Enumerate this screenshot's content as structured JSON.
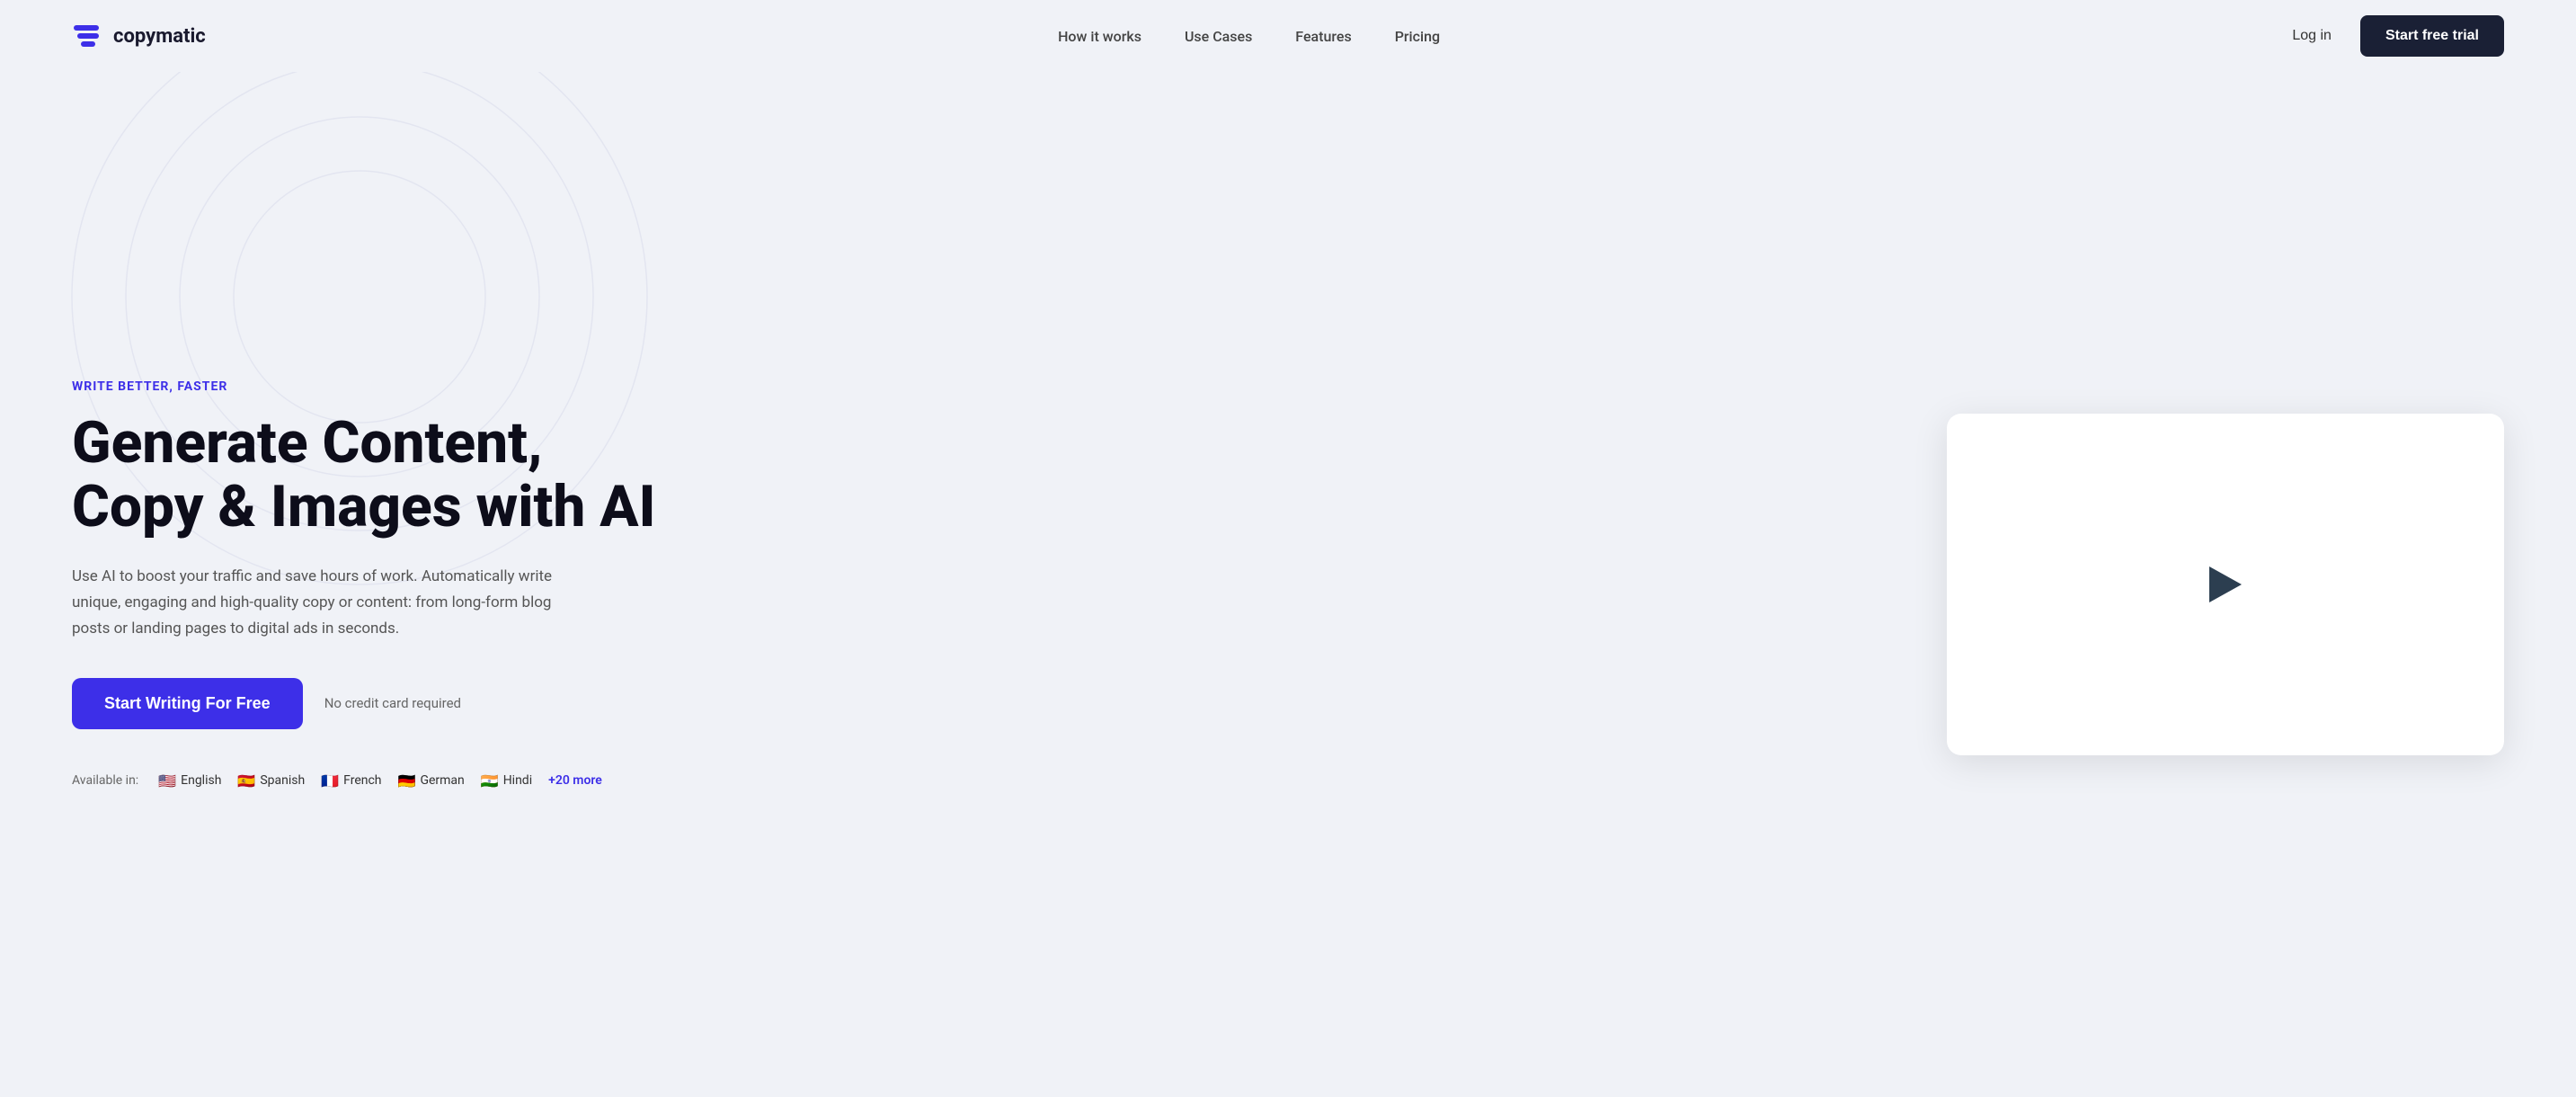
{
  "brand": {
    "name": "copymatic"
  },
  "nav": {
    "links": [
      {
        "label": "How it works",
        "href": "#"
      },
      {
        "label": "Use Cases",
        "href": "#"
      },
      {
        "label": "Features",
        "href": "#"
      },
      {
        "label": "Pricing",
        "href": "#"
      }
    ],
    "login_label": "Log in",
    "trial_label": "Start free trial"
  },
  "hero": {
    "eyebrow": "WRITE BETTER, FASTER",
    "title_line1": "Generate Content,",
    "title_line2": "Copy & Images with AI",
    "description": "Use AI to boost your traffic and save hours of work. Automatically write unique, engaging and high-quality copy or content: from long-form blog posts or landing pages to digital ads in seconds.",
    "cta_primary": "Start Writing For Free",
    "no_cc": "No credit card required"
  },
  "languages": {
    "label": "Available in:",
    "items": [
      {
        "flag": "🇺🇸",
        "name": "English"
      },
      {
        "flag": "🇪🇸",
        "name": "Spanish"
      },
      {
        "flag": "🇫🇷",
        "name": "French"
      },
      {
        "flag": "🇩🇪",
        "name": "German"
      },
      {
        "flag": "🇮🇳",
        "name": "Hindi"
      }
    ],
    "more": "+20 more"
  }
}
